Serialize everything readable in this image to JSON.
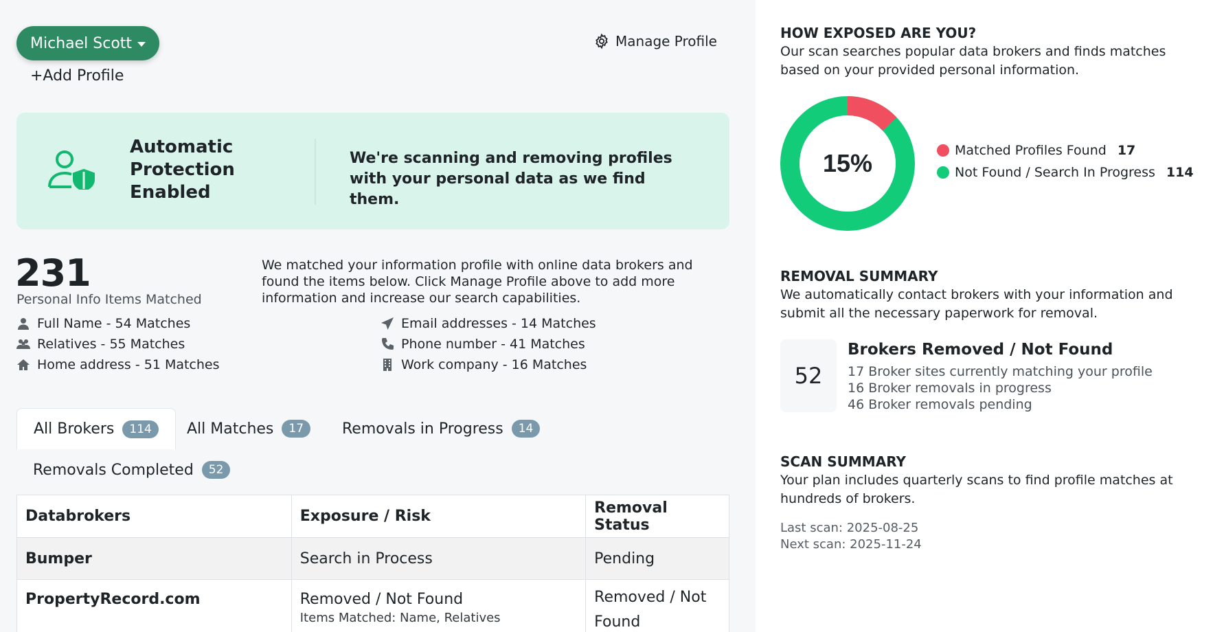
{
  "header": {
    "profile_name": "Michael Scott",
    "add_profile": "+Add Profile",
    "manage_profile": "Manage Profile"
  },
  "banner": {
    "title": "Automatic Protection Enabled",
    "text": "We're scanning and removing profiles with your personal data as we find them."
  },
  "matches": {
    "total": "231",
    "total_label": "Personal Info Items Matched",
    "description": "We matched your information profile with online data brokers and found the items below. Click Manage Profile above to add more information and increase our search capabilities.",
    "categories": [
      {
        "icon": "person-icon",
        "label": "Full Name - 54 Matches"
      },
      {
        "icon": "group-icon",
        "label": "Relatives - 55 Matches"
      },
      {
        "icon": "home-icon",
        "label": "Home address - 51 Matches"
      },
      {
        "icon": "send-icon",
        "label": "Email addresses - 14 Matches"
      },
      {
        "icon": "phone-icon",
        "label": "Phone number - 41 Matches"
      },
      {
        "icon": "building-icon",
        "label": "Work company - 16 Matches"
      }
    ]
  },
  "tabs": [
    {
      "label": "All Brokers",
      "count": "114"
    },
    {
      "label": "All Matches",
      "count": "17"
    },
    {
      "label": "Removals in Progress",
      "count": "14"
    },
    {
      "label": "Removals Completed",
      "count": "52"
    }
  ],
  "table": {
    "headers": [
      "Databrokers",
      "Exposure / Risk",
      "Removal Status"
    ],
    "rows": [
      {
        "broker": "Bumper",
        "exposure": "Search in Process",
        "detail": "",
        "status": "Pending"
      },
      {
        "broker": "PropertyRecord.com",
        "exposure": "Removed / Not Found",
        "detail": "Items Matched: Name, Relatives",
        "status": "Removed / Not Found"
      }
    ]
  },
  "exposure": {
    "title": "HOW EXPOSED ARE YOU?",
    "text": "Our scan searches popular data brokers and finds matches based on your provided personal information.",
    "percent": "15%",
    "legend": [
      {
        "label": "Matched Profiles Found",
        "count": "17",
        "color": "#ef4f5f"
      },
      {
        "label": "Not Found / Search In Progress",
        "count": "114",
        "color": "#12cc7a"
      }
    ],
    "matched_fraction": 0.13
  },
  "removal": {
    "title": "REMOVAL SUMMARY",
    "text": "We automatically contact brokers with your information and submit all the necessary paperwork for removal.",
    "count": "52",
    "heading": "Brokers Removed / Not Found",
    "lines": [
      "17 Broker sites currently matching your profile",
      "16 Broker removals in progress",
      "46 Broker removals pending"
    ]
  },
  "scan": {
    "title": "SCAN SUMMARY",
    "text": "Your plan includes quarterly scans to find profile matches at hundreds of brokers.",
    "last": "Last scan: 2025-08-25",
    "next": "Next scan: 2025-11-24"
  },
  "colors": {
    "brand_green": "#2d8a63",
    "banner_bg": "#d9f4ea",
    "badge": "#7a9aac"
  }
}
